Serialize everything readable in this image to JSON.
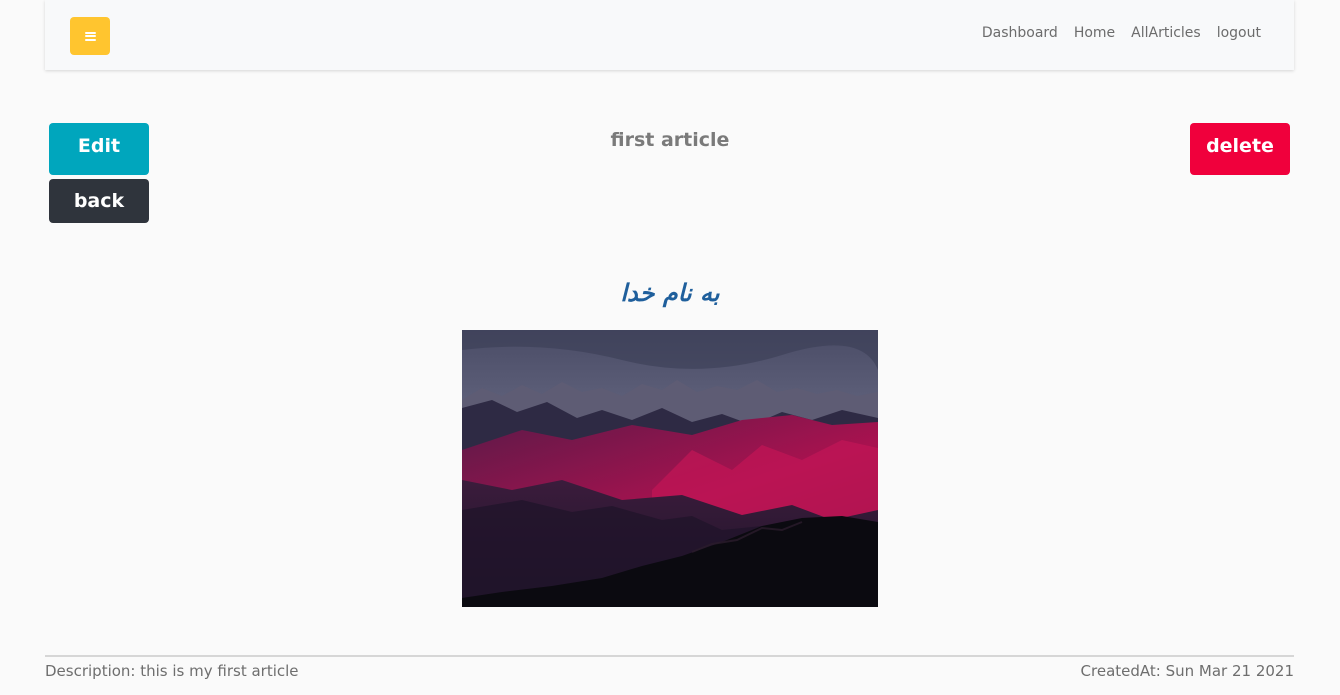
{
  "navbar": {
    "menu_icon": "hamburger-icon",
    "menu_color": "#ffc52f",
    "links": [
      "Dashboard",
      "Home",
      "AllArticles",
      "logout"
    ]
  },
  "actions": {
    "edit_label": "Edit",
    "back_label": "back",
    "delete_label": "delete",
    "edit_color": "#00a6bd",
    "back_color": "#2f343c",
    "delete_color": "#f0003c"
  },
  "article": {
    "title": "first article",
    "heading": "به نام خدا",
    "image_alt": "mountain landscape at dusk"
  },
  "footer": {
    "description": "Description: this is my first article",
    "created_at": "CreatedAt: Sun Mar 21 2021"
  }
}
